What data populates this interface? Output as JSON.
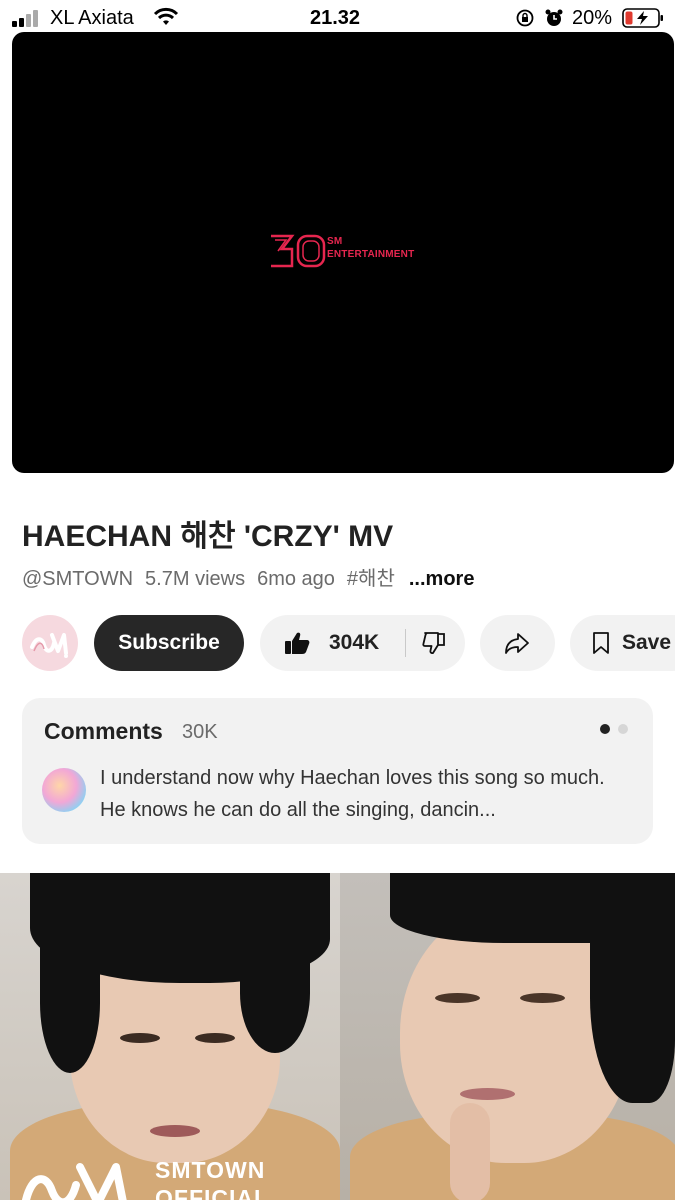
{
  "status_bar": {
    "carrier": "XL Axiata",
    "time": "21.32",
    "battery_percent": "20%"
  },
  "video": {
    "logo_number": "30",
    "logo_line1": "SM",
    "logo_line2": "ENTERTAINMENT",
    "accent_color": "#e6264f"
  },
  "details": {
    "title": "HAECHAN 해찬 'CRZY' MV",
    "channel": "@SMTOWN",
    "views": "5.7M views",
    "age": "6mo ago",
    "hashtag": "#해찬",
    "more": "...more"
  },
  "actions": {
    "subscribe_label": "Subscribe",
    "like_count": "304K",
    "save_label": "Save"
  },
  "comments": {
    "title": "Comments",
    "count": "30K",
    "top_comment": "I understand now why Haechan loves this song so much. He knows he can do all the singing, dancin..."
  },
  "thumbnail": {
    "brand_line1": "SMTOWN",
    "brand_line2": "OFFICIAL"
  }
}
